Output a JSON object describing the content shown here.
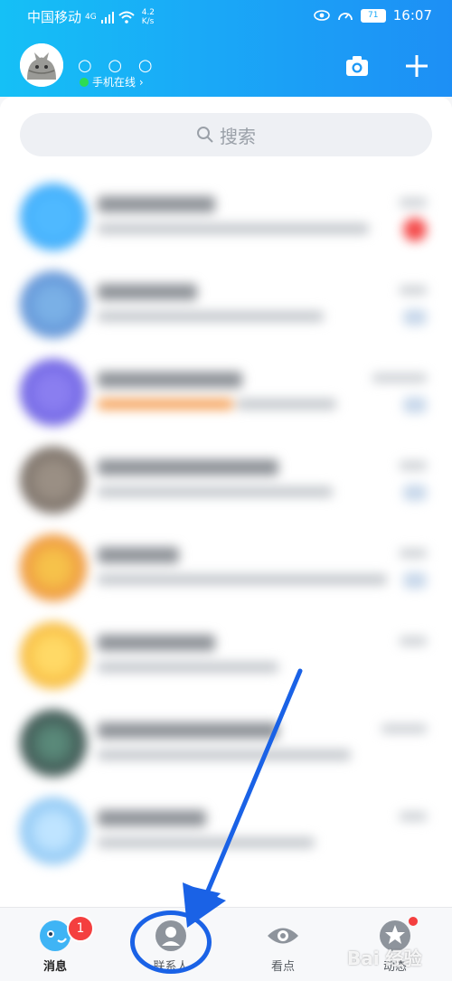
{
  "status_bar": {
    "carrier": "中国移动",
    "network": "4G",
    "speed_value": "4.2",
    "speed_unit": "K/s",
    "battery": "71",
    "time": "16:07"
  },
  "header": {
    "nickname": "○ ○ ○",
    "online_status": "手机在线 ›",
    "camera_icon": "camera-icon",
    "plus_icon": "plus-icon"
  },
  "search": {
    "placeholder": "搜索"
  },
  "tabs": [
    {
      "label": "消息",
      "icon": "message-icon",
      "badge": "1"
    },
    {
      "label": "联系人",
      "icon": "contacts-icon"
    },
    {
      "label": "看点",
      "icon": "eye-icon"
    },
    {
      "label": "动态",
      "icon": "star-icon"
    }
  ],
  "watermark": "Bai 经验",
  "colors": {
    "header_accent": "#1aa9f7",
    "badge_red": "#f43f3f",
    "annotation_blue": "#1a62e6"
  }
}
